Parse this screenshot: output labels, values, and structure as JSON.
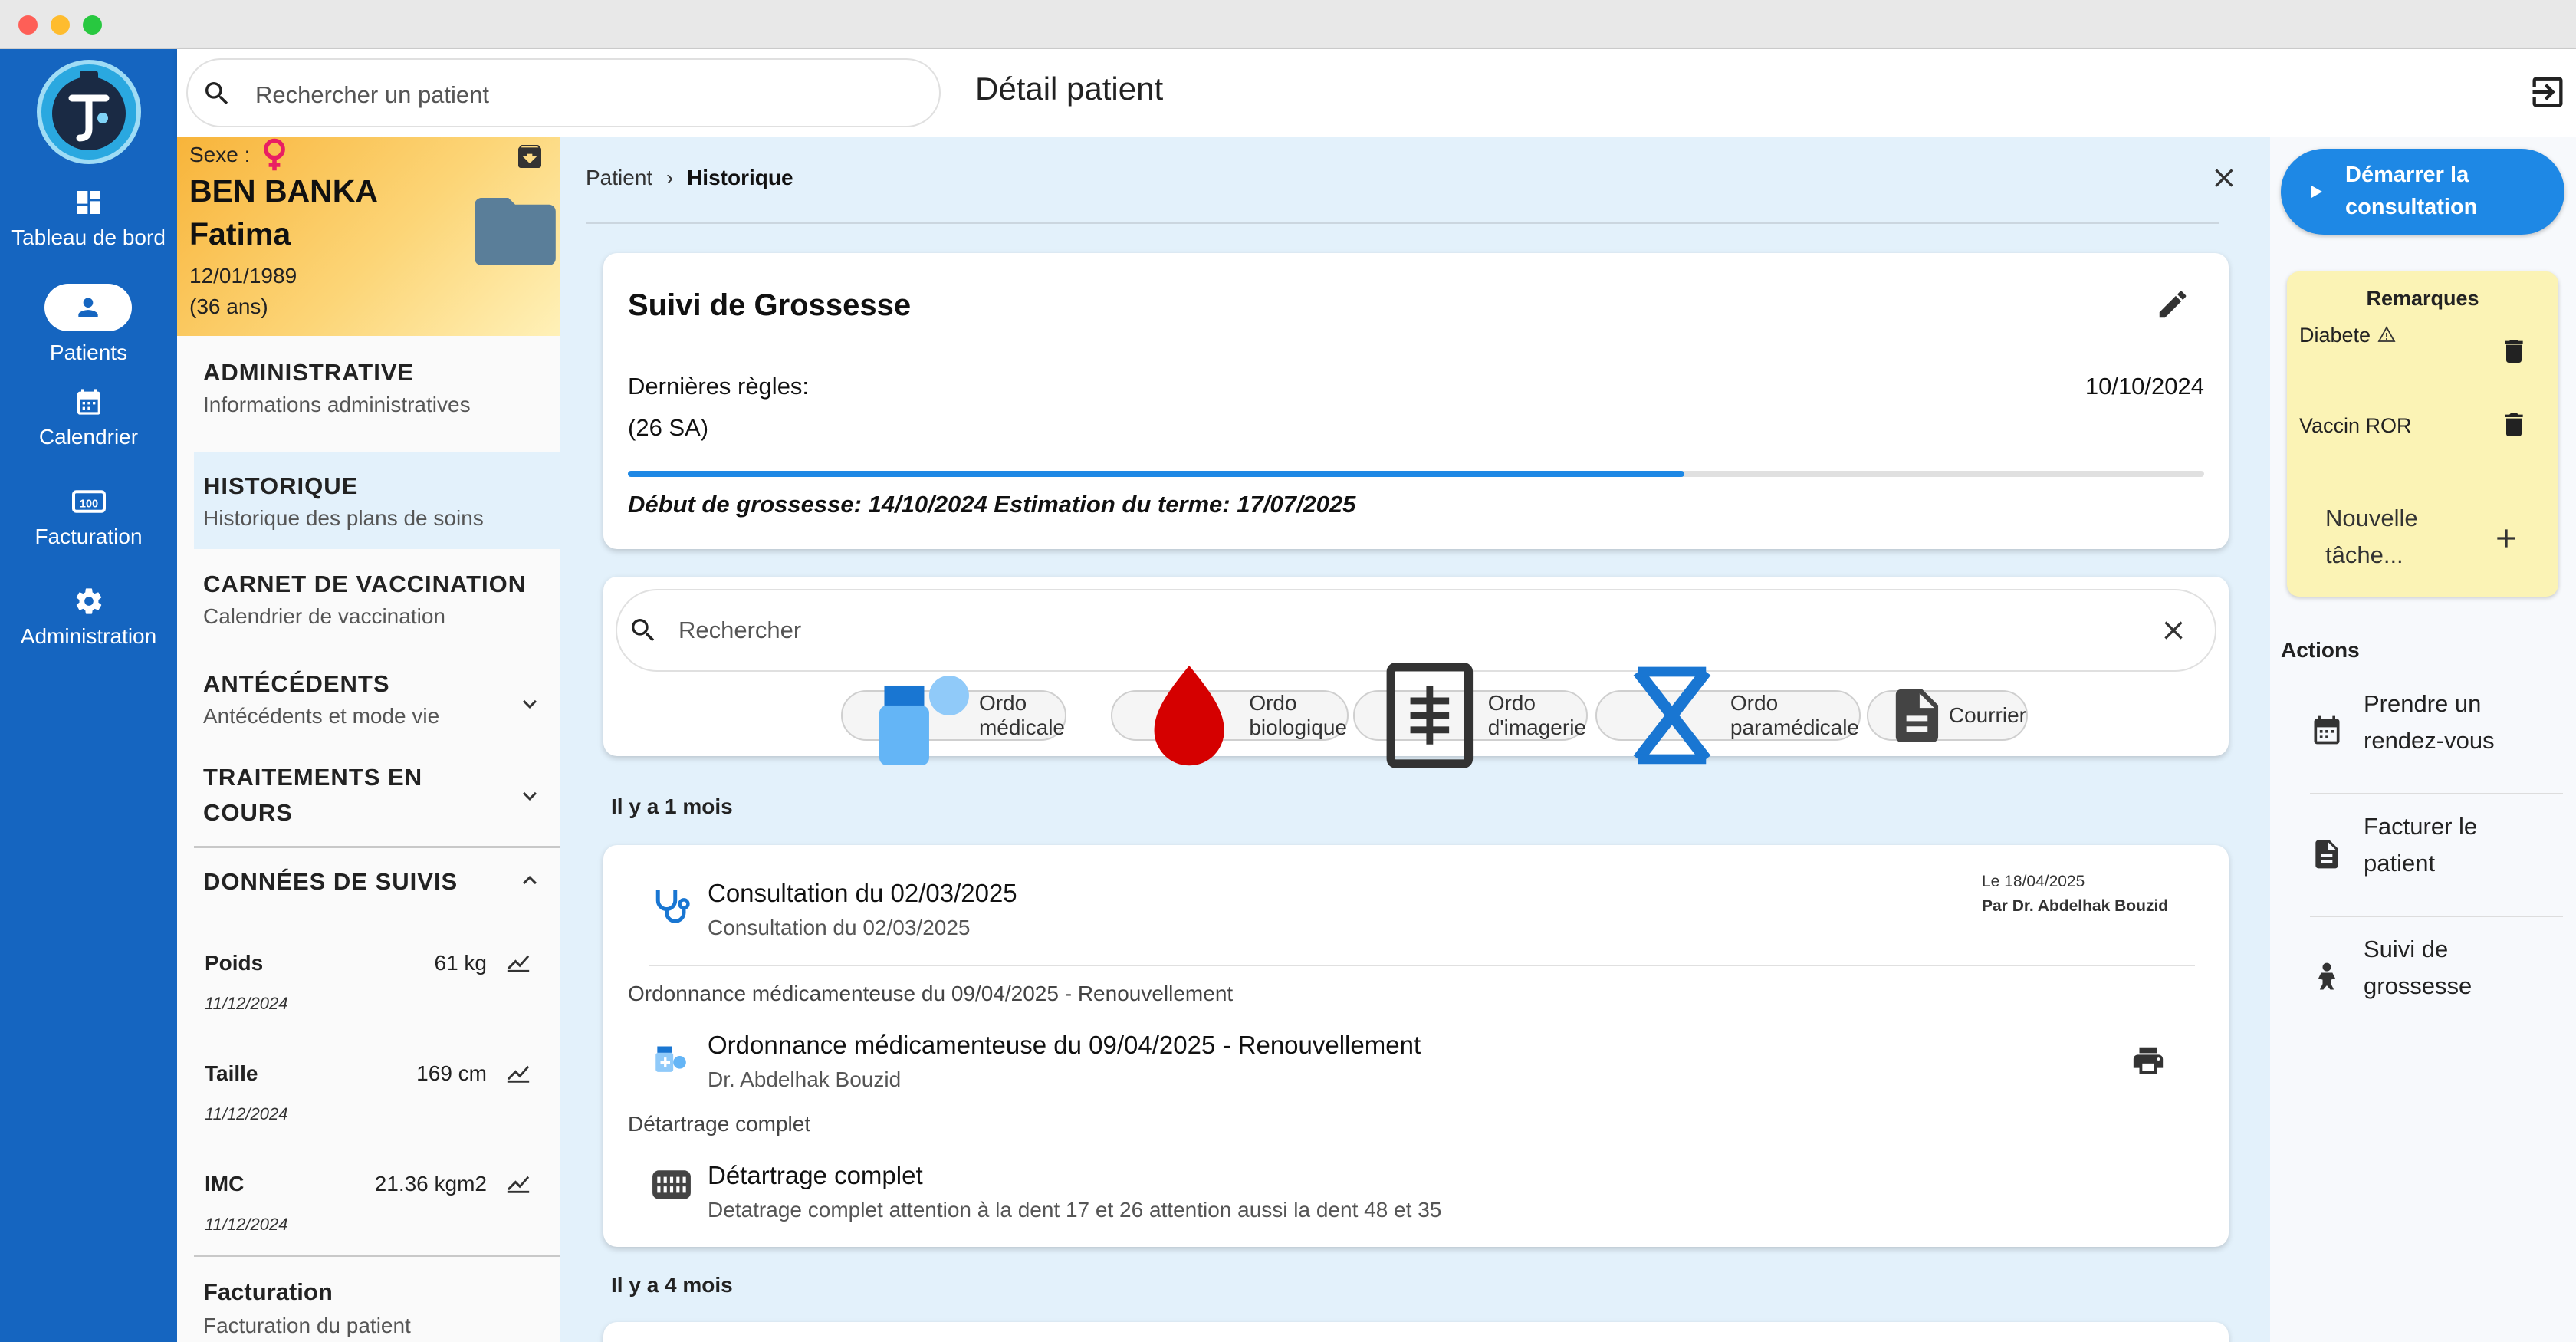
{
  "colors": {
    "nav": "#1565c0",
    "accent": "#1e88e5",
    "notes": "#fbf3b5",
    "gender": "#e91e63"
  },
  "nav": {
    "items": [
      {
        "label": "Tableau de bord",
        "icon": "dashboard-icon"
      },
      {
        "label": "Patients",
        "icon": "person-icon",
        "active": true
      },
      {
        "label": "Calendrier",
        "icon": "calendar-icon"
      },
      {
        "label": "Facturation",
        "icon": "billing-icon"
      },
      {
        "label": "Administration",
        "icon": "gear-icon"
      }
    ]
  },
  "topbar": {
    "search_placeholder": "Rechercher un patient",
    "title": "Détail patient"
  },
  "patient": {
    "sex_label": "Sexe :",
    "last_name": "BEN BANKA",
    "first_name": "Fatima",
    "dob": "12/01/1989",
    "age": "(36 ans)"
  },
  "menu": [
    {
      "title": "ADMINISTRATIVE",
      "subtitle": "Informations administratives"
    },
    {
      "title": "HISTORIQUE",
      "subtitle": "Historique des plans de soins",
      "active": true
    },
    {
      "title": "CARNET DE VACCINATION",
      "subtitle": "Calendrier de vaccination"
    },
    {
      "title": "ANTÉCÉDENTS",
      "subtitle": "Antécédents et mode vie"
    },
    {
      "title_line1": "TRAITEMENTS EN",
      "title_line2": "COURS"
    },
    {
      "title": "DONNÉES DE SUIVIS"
    }
  ],
  "metrics": [
    {
      "label": "Poids",
      "value": "61 kg",
      "date": "11/12/2024"
    },
    {
      "label": "Taille",
      "value": "169 cm",
      "date": "11/12/2024"
    },
    {
      "label": "IMC",
      "value": "21.36 kgm2",
      "date": "11/12/2024"
    }
  ],
  "billing": {
    "title": "Facturation",
    "subtitle": "Facturation du patient"
  },
  "breadcrumb": {
    "root": "Patient",
    "current": "Historique"
  },
  "pregnancy": {
    "title": "Suivi de Grossesse",
    "last_period_label": "Dernières règles:",
    "last_period_date": "10/10/2024",
    "weeks": "(26 SA)",
    "progress": 0.67,
    "summary": "Début de grossesse: 14/10/2024 Estimation du terme: 17/07/2025"
  },
  "filter": {
    "search_placeholder": "Rechercher",
    "chips": [
      {
        "label": "Ordo médicale",
        "icon": "medication-icon"
      },
      {
        "label": "Ordo biologique",
        "icon": "blood-drop-icon"
      },
      {
        "label": "Ordo d'imagerie",
        "icon": "xray-icon"
      },
      {
        "label": "Ordo paramédicale",
        "icon": "paramedical-icon"
      },
      {
        "label": "Courrier",
        "icon": "document-icon"
      }
    ]
  },
  "timeline": {
    "group1": "Il y a 1 mois",
    "group2": "Il y a 4 mois",
    "consultation": {
      "title": "Consultation du 02/03/2025",
      "subtitle": "Consultation du 02/03/2025",
      "date": "Le 18/04/2025",
      "author": "Par Dr. Abdelhak Bouzid"
    },
    "ordonnance": {
      "section": "Ordonnance médicamenteuse du 09/04/2025 - Renouvellement",
      "title": "Ordonnance médicamenteuse du 09/04/2025 - Renouvellement",
      "subtitle": "Dr. Abdelhak Bouzid"
    },
    "detartrage": {
      "section": "Détartrage complet",
      "title": "Détartrage complet",
      "subtitle": "Detatrage complet attention à la dent 17 et 26 attention aussi la dent 48 et 35"
    }
  },
  "right": {
    "start_line1": "Démarrer la",
    "start_line2": "consultation",
    "notes_title": "Remarques",
    "notes": [
      {
        "text": "Diabete",
        "warning": true
      },
      {
        "text": "Vaccin ROR"
      }
    ],
    "new_task_line1": "Nouvelle",
    "new_task_line2": "tâche...",
    "actions_title": "Actions",
    "actions": [
      {
        "line1": "Prendre un",
        "line2": "rendez-vous",
        "icon": "calendar-icon"
      },
      {
        "line1": "Facturer le",
        "line2": "patient",
        "icon": "invoice-icon"
      },
      {
        "line1": "Suivi de",
        "line2": "grossesse",
        "icon": "baby-icon"
      }
    ]
  }
}
